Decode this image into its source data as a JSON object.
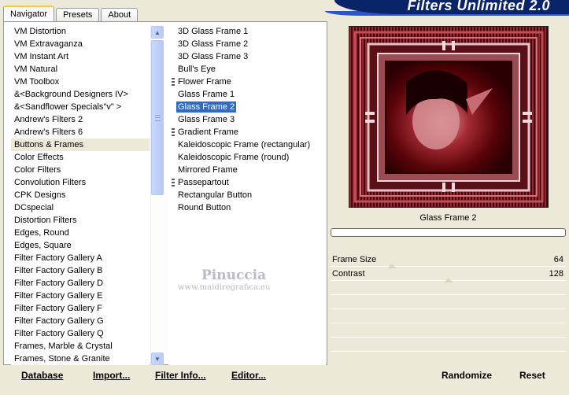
{
  "banner": {
    "title": "Filters Unlimited 2.0"
  },
  "tabs": [
    {
      "label": "Navigator",
      "active": true
    },
    {
      "label": "Presets",
      "active": false
    },
    {
      "label": "About",
      "active": false
    }
  ],
  "categories": {
    "selected": "Buttons & Frames",
    "items": [
      "VM Distortion",
      "VM Extravaganza",
      "VM Instant Art",
      "VM Natural",
      "VM Toolbox",
      "&<Background Designers IV>",
      "&<Sandflower Specials\"v\" >",
      "Andrew's Filters 2",
      "Andrew's Filters 6",
      "Buttons & Frames",
      "Color Effects",
      "Color Filters",
      "Convolution Filters",
      "CPK Designs",
      "DCspecial",
      "Distortion Filters",
      "Edges, Round",
      "Edges, Square",
      "Filter Factory Gallery A",
      "Filter Factory Gallery B",
      "Filter Factory Gallery D",
      "Filter Factory Gallery E",
      "Filter Factory Gallery F",
      "Filter Factory Gallery G",
      "Filter Factory Gallery Q",
      "Frames, Marble & Crystal",
      "Frames, Stone & Granite"
    ]
  },
  "filters": {
    "selected": "Glass Frame 2",
    "items": [
      {
        "label": "3D Glass Frame 1",
        "group": false
      },
      {
        "label": "3D Glass Frame 2",
        "group": false
      },
      {
        "label": "3D Glass Frame 3",
        "group": false
      },
      {
        "label": "Bull's Eye",
        "group": false
      },
      {
        "label": "Flower Frame",
        "group": true
      },
      {
        "label": "Glass Frame 1",
        "group": false
      },
      {
        "label": "Glass Frame 2",
        "group": false
      },
      {
        "label": "Glass Frame 3",
        "group": false
      },
      {
        "label": "Gradient Frame",
        "group": true
      },
      {
        "label": "Kaleidoscopic Frame (rectangular)",
        "group": false
      },
      {
        "label": "Kaleidoscopic Frame (round)",
        "group": false
      },
      {
        "label": "Mirrored Frame",
        "group": false
      },
      {
        "label": "Passepartout",
        "group": true
      },
      {
        "label": "Rectangular Button",
        "group": false
      },
      {
        "label": "Round Button",
        "group": false
      }
    ]
  },
  "watermark": {
    "name": "Pinuccia",
    "url": "www.maidiregrafica.eu"
  },
  "preview": {
    "caption": "Glass Frame 2",
    "progress_percent": 0
  },
  "params": [
    {
      "label": "Frame Size",
      "value": "64",
      "max": 255
    },
    {
      "label": "Contrast",
      "value": "128",
      "max": 255
    }
  ],
  "buttons": {
    "database": "Database",
    "import": "Import...",
    "filter_info": "Filter Info...",
    "editor": "Editor...",
    "randomize": "Randomize",
    "reset": "Reset"
  },
  "colors": {
    "selection": "#316ac5",
    "banner": "#0a246a",
    "preview_dark": "#3e0006",
    "preview_red": "#c04a52"
  }
}
